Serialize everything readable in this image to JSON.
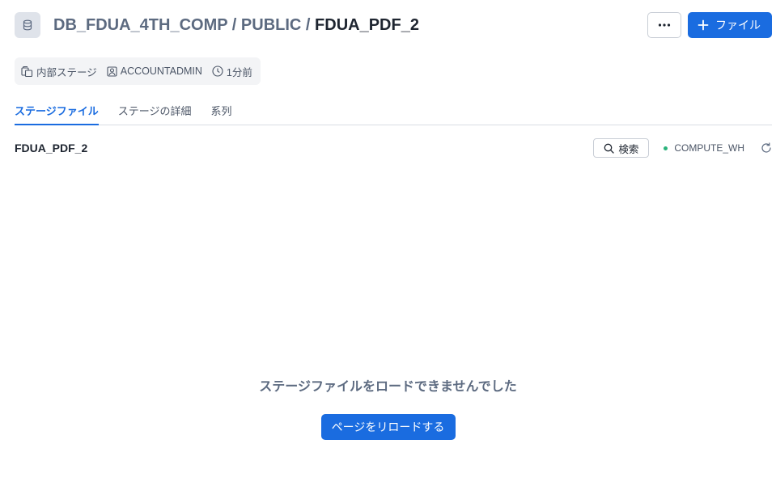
{
  "header": {
    "db_icon": "database-icon",
    "crumb_database": "DB_FDUA_4TH_COMP",
    "crumb_sep1": " / ",
    "crumb_schema": "PUBLIC",
    "crumb_sep2": " / ",
    "crumb_stage": "FDUA_PDF_2",
    "more_icon": "ellipsis-icon",
    "add_file_label": "ファイル",
    "add_file_icon": "plus-icon"
  },
  "meta": {
    "stage_type": "内部ステージ",
    "owner": "ACCOUNTADMIN",
    "updated": "1分前"
  },
  "tabs": [
    {
      "label": "ステージファイル",
      "active": true
    },
    {
      "label": "ステージの詳細",
      "active": false
    },
    {
      "label": "系列",
      "active": false
    }
  ],
  "subbar": {
    "stage_name": "FDUA_PDF_2",
    "search_label": "検索",
    "warehouse": "COMPUTE_WH",
    "warehouse_status_color": "#2ab27b"
  },
  "empty_state": {
    "message": "ステージファイルをロードできませんでした",
    "reload_label": "ページをリロードする"
  },
  "colors": {
    "accent": "#1a6ce0",
    "muted_text": "#5c6a80"
  }
}
